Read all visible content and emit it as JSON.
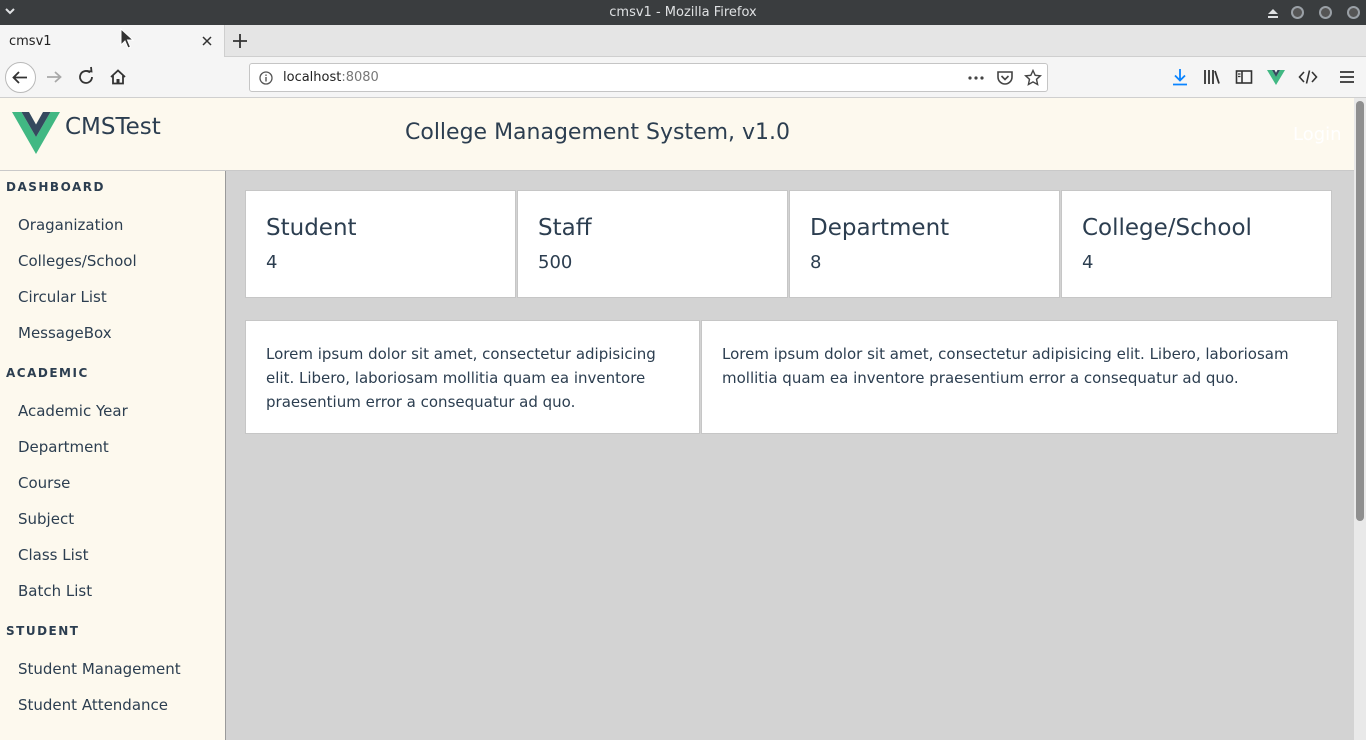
{
  "window": {
    "title": "cmsv1 - Mozilla Firefox"
  },
  "tab": {
    "title": "cmsv1"
  },
  "urlbar": {
    "host": "localhost",
    "port": ":8080"
  },
  "header": {
    "brand": "CMSTest",
    "title": "College Management System, v1.0",
    "login": "Login"
  },
  "sidebar": {
    "sections": [
      {
        "heading": "DASHBOARD",
        "items": [
          "Oraganization",
          "Colleges/School",
          "Circular List",
          "MessageBox"
        ]
      },
      {
        "heading": "ACADEMIC",
        "items": [
          "Academic Year",
          "Department",
          "Course",
          "Subject",
          "Class List",
          "Batch List"
        ]
      },
      {
        "heading": "STUDENT",
        "items": [
          "Student Management",
          "Student Attendance"
        ]
      }
    ]
  },
  "stats": [
    {
      "title": "Student",
      "value": "4"
    },
    {
      "title": "Staff",
      "value": "500"
    },
    {
      "title": "Department",
      "value": "8"
    },
    {
      "title": "College/School",
      "value": "4"
    }
  ],
  "texts": [
    "Lorem ipsum dolor sit amet, consectetur adipisicing elit. Libero, laboriosam mollitia quam ea inventore praesentium error a consequatur ad quo.",
    "Lorem ipsum dolor sit amet, consectetur adipisicing elit. Libero, laboriosam mollitia quam ea inventore praesentium error a consequatur ad quo."
  ],
  "colors": {
    "header_bg": "#fdf9ee",
    "text": "#2c3e50",
    "main_bg": "#d3d3d3",
    "vue_green": "#41b883",
    "vue_dark": "#35495e"
  }
}
